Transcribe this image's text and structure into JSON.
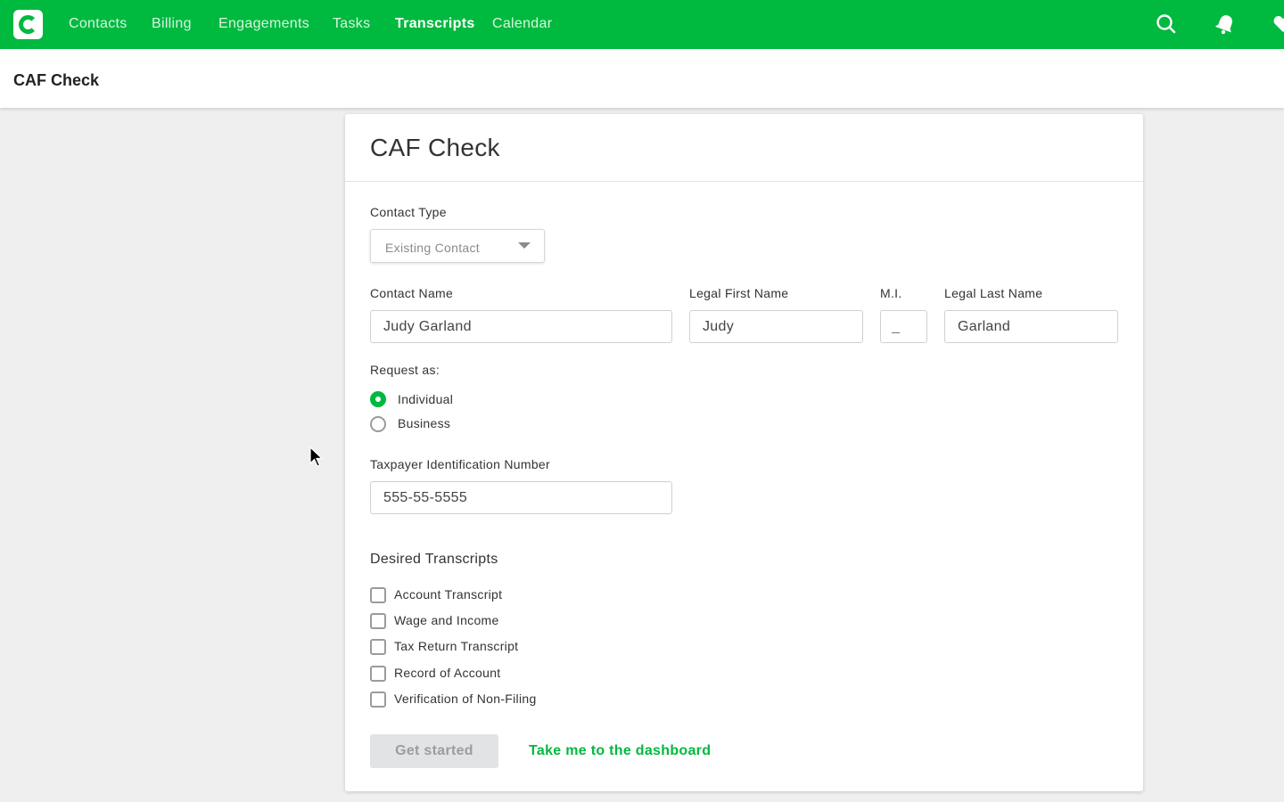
{
  "nav": {
    "items": [
      {
        "label": "Contacts",
        "active": false
      },
      {
        "label": "Billing",
        "active": false
      },
      {
        "label": "Engagements",
        "active": false
      },
      {
        "label": "Tasks",
        "active": false
      },
      {
        "label": "Transcripts",
        "active": true
      },
      {
        "label": "Calendar",
        "active": false
      }
    ],
    "icons": [
      "search-icon",
      "bell-icon",
      "heart-icon"
    ],
    "brand_color": "#00b93f"
  },
  "page": {
    "title": "CAF Check"
  },
  "form": {
    "heading": "CAF Check",
    "contact_type": {
      "label": "Contact Type",
      "value": "Existing Contact"
    },
    "contact_name": {
      "label": "Contact Name",
      "value": "Judy Garland"
    },
    "first_name": {
      "label": "Legal First Name",
      "value": "Judy"
    },
    "mi": {
      "label": "M.I.",
      "value": "_"
    },
    "last_name": {
      "label": "Legal Last Name",
      "value": "Garland"
    },
    "request_as": {
      "label": "Request as:",
      "options": [
        {
          "label": "Individual",
          "selected": true
        },
        {
          "label": "Business",
          "selected": false
        }
      ]
    },
    "tin": {
      "label": "Taxpayer Identification Number",
      "value": "555-55-5555"
    },
    "transcripts": {
      "title": "Desired Transcripts",
      "options": [
        {
          "label": "Account Transcript",
          "checked": false
        },
        {
          "label": "Wage and Income",
          "checked": false
        },
        {
          "label": "Tax Return Transcript",
          "checked": false
        },
        {
          "label": "Record of Account",
          "checked": false
        },
        {
          "label": "Verification of Non-Filing",
          "checked": false
        }
      ]
    },
    "start_button": "Get started",
    "dashboard_link": "Take me to the dashboard"
  }
}
